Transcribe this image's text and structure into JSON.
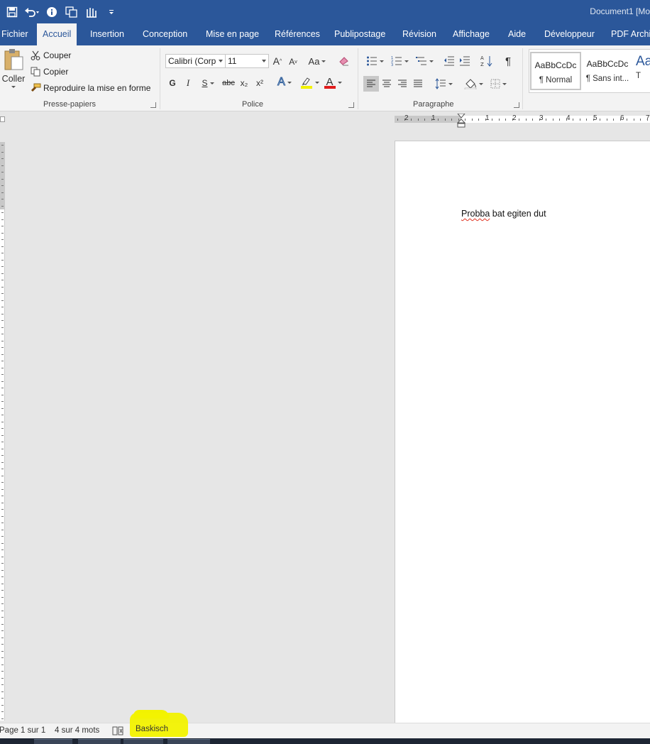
{
  "window": {
    "title": "Document1 [Mo"
  },
  "quick_access": [
    "save-icon",
    "undo-icon",
    "info-icon",
    "copy-pages-icon",
    "touch-mode-icon",
    "customize-icon"
  ],
  "tabs": [
    "Fichier",
    "Accueil",
    "Insertion",
    "Conception",
    "Mise en page",
    "Références",
    "Publipostage",
    "Révision",
    "Affichage",
    "Aide",
    "Développeur",
    "PDF Archit"
  ],
  "active_tab": "Accueil",
  "clipboard": {
    "paste_label": "Coller",
    "cut_label": "Couper",
    "copy_label": "Copier",
    "format_painter_label": "Reproduire la mise en forme",
    "group_label": "Presse-papiers"
  },
  "font": {
    "name": "Calibri (Corp",
    "size": "11",
    "grow": "A",
    "shrink": "A",
    "case": "Aa",
    "bold": "G",
    "italic": "I",
    "underline": "S",
    "strike": "abc",
    "subscript": "x₂",
    "superscript": "x²",
    "text_effects": "A",
    "font_color": "A",
    "group_label": "Police",
    "colors": {
      "highlight": "#f2f200",
      "font_color": "#e01c1c"
    }
  },
  "paragraph": {
    "sort": "A↓Z",
    "pilcrow": "¶",
    "group_label": "Paragraphe"
  },
  "styles": {
    "items": [
      {
        "sample": "AaBbCcDc",
        "name": "¶ Normal"
      },
      {
        "sample": "AaBbCcDc",
        "name": "¶ Sans int..."
      },
      {
        "sample": "Aa",
        "name": "T"
      }
    ]
  },
  "ruler": {
    "numbers": [
      "2",
      "1",
      "1",
      "2",
      "3",
      "4",
      "5",
      "6",
      "7"
    ]
  },
  "document": {
    "text_word1": "Probba",
    "text_rest": " bat egiten dut"
  },
  "status": {
    "page": "Page 1 sur 1",
    "words": "4 sur 4 mots",
    "language": "Baskisch"
  },
  "colors": {
    "accent": "#2b579a",
    "ribbon_bg": "#f3f3f3",
    "workspace": "#e6e6e6"
  }
}
